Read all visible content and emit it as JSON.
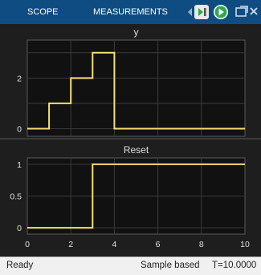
{
  "toolstrip": {
    "tabs": [
      {
        "label": "SCOPE",
        "selected": false
      },
      {
        "label": "MEASUREMENTS",
        "selected": true
      }
    ],
    "icons": [
      "collapse-arrow-icon",
      "step-forward-icon",
      "run-icon",
      "undock-icon",
      "close-icon"
    ],
    "colors": {
      "background": "#0f4c81",
      "run": "#2fa84f"
    }
  },
  "colors": {
    "axes_bg": "#111111",
    "grid": "#3a3a3a",
    "line": "#f5e16b",
    "text": "#e0e0e0"
  },
  "chart_data": [
    {
      "type": "line",
      "title": "y",
      "xlim": [
        0,
        10
      ],
      "ylim": [
        -0.3,
        3.5
      ],
      "yticks": [
        0,
        2
      ],
      "yticks_minor": [
        1,
        3
      ],
      "xticks": [
        0,
        2,
        4,
        6,
        8,
        10
      ],
      "show_xtick_labels": false,
      "grid": true,
      "series": [
        {
          "step": true,
          "x": [
            0,
            1,
            1,
            2,
            2,
            3,
            3,
            4,
            4,
            10
          ],
          "y": [
            0,
            0,
            1,
            1,
            2,
            2,
            3,
            3,
            0,
            0
          ]
        }
      ]
    },
    {
      "type": "line",
      "title": "Reset",
      "xlim": [
        0,
        10
      ],
      "ylim": [
        -0.1,
        1.1
      ],
      "yticks": [
        0,
        0.5,
        1
      ],
      "yticklabels": [
        "0",
        "0.5",
        "1"
      ],
      "xticks": [
        0,
        2,
        4,
        6,
        8,
        10
      ],
      "show_xtick_labels": true,
      "grid": true,
      "series": [
        {
          "step": true,
          "x": [
            0,
            3,
            3,
            10
          ],
          "y": [
            0,
            0,
            1,
            1
          ]
        }
      ]
    }
  ],
  "status": {
    "ready": "Ready",
    "mode": "Sample based",
    "time": "T=10.0000"
  }
}
